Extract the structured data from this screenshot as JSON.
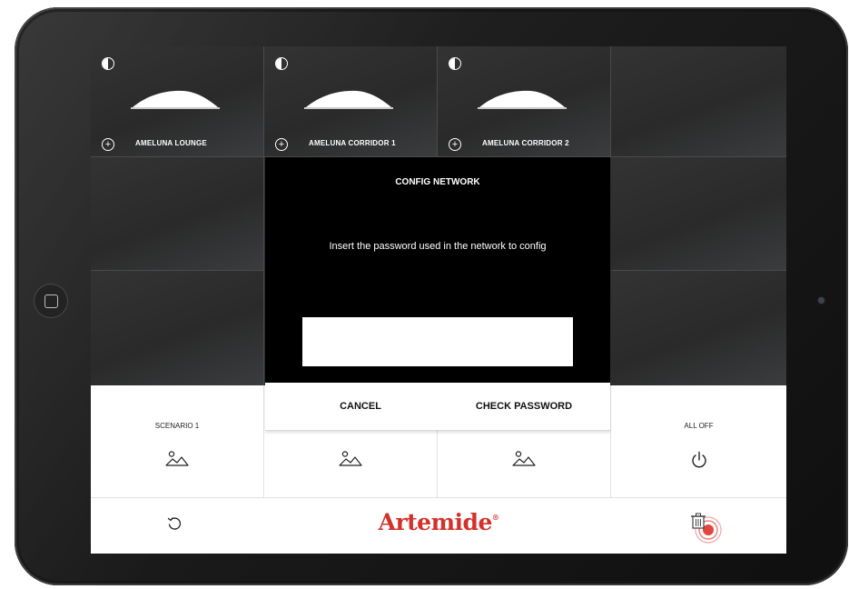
{
  "lamps": [
    {
      "name": "AMELUNA LOUNGE"
    },
    {
      "name": "AMELUNA CORRIDOR 1"
    },
    {
      "name": "AMELUNA CORRIDOR 2"
    }
  ],
  "modal": {
    "title": "CONFIG NETWORK",
    "message": "Insert the password used in the network to config",
    "password_value": "",
    "cancel_label": "CANCEL",
    "check_label": "CHECK PASSWORD"
  },
  "scenarios": {
    "scenario1_label": "SCENARIO 1",
    "all_off_label": "ALL OFF"
  },
  "footer": {
    "logo_text": "Artemide",
    "logo_mark": "®"
  },
  "colors": {
    "brand_red": "#d5312b",
    "modal_bg": "#000000",
    "tile_bg": "#2c2c2c"
  },
  "icons": {
    "dimmer": "half-circle-icon",
    "add": "plus-circle-icon",
    "scene": "landscape-icon",
    "power": "power-icon",
    "undo": "undo-icon",
    "delete": "trash-icon"
  }
}
